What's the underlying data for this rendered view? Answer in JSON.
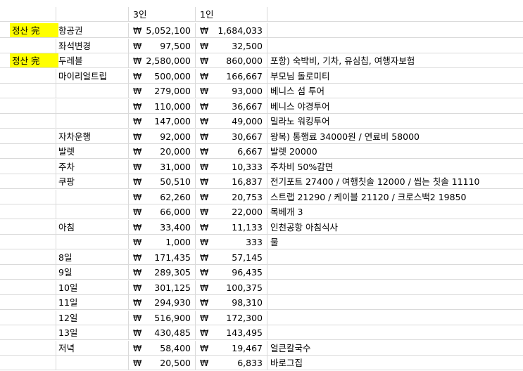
{
  "header": {
    "col3": "3인",
    "col1": "1인"
  },
  "currency_symbol": "₩",
  "highlight_color": "#ffff00",
  "rows": [
    {
      "status": "정산 完",
      "category": "항공권",
      "amount3": "5,052,100",
      "amount1": "1,684,033",
      "note": ""
    },
    {
      "status": "",
      "category": "좌석변경",
      "amount3": "97,500",
      "amount1": "32,500",
      "note": ""
    },
    {
      "status": "정산 完",
      "category": "두레블",
      "amount3": "2,580,000",
      "amount1": "860,000",
      "note": "포항) 숙박비, 기차, 유심칩, 여행자보험"
    },
    {
      "status": "",
      "category": "마이리얼트립",
      "amount3": "500,000",
      "amount1": "166,667",
      "note": "부모님 돌로미티"
    },
    {
      "status": "",
      "category": "",
      "amount3": "279,000",
      "amount1": "93,000",
      "note": "베니스 섬 투어"
    },
    {
      "status": "",
      "category": "",
      "amount3": "110,000",
      "amount1": "36,667",
      "note": "베니스 야경투어"
    },
    {
      "status": "",
      "category": "",
      "amount3": "147,000",
      "amount1": "49,000",
      "note": "밀라노 워킹투어"
    },
    {
      "status": "",
      "category": "자차운행",
      "amount3": "92,000",
      "amount1": "30,667",
      "note": "왕복) 통행료 34000원 / 연료비 58000"
    },
    {
      "status": "",
      "category": "발렛",
      "amount3": "20,000",
      "amount1": "6,667",
      "note": "발렛 20000"
    },
    {
      "status": "",
      "category": "주차",
      "amount3": "31,000",
      "amount1": "10,333",
      "note": "주차비 50%감면"
    },
    {
      "status": "",
      "category": "쿠팡",
      "amount3": "50,510",
      "amount1": "16,837",
      "note": "전기포트 27400 / 여행칫솔 12000 / 씹는 칫솔 11110"
    },
    {
      "status": "",
      "category": "",
      "amount3": "62,260",
      "amount1": "20,753",
      "note": "스트랩 21290 / 케이블 21120 / 크로스백2 19850"
    },
    {
      "status": "",
      "category": "",
      "amount3": "66,000",
      "amount1": "22,000",
      "note": "목베개 3"
    },
    {
      "status": "",
      "category": "아침",
      "amount3": "33,400",
      "amount1": "11,133",
      "note": "인천공항 아침식사"
    },
    {
      "status": "",
      "category": "",
      "amount3": "1,000",
      "amount1": "333",
      "note": "물"
    },
    {
      "status": "",
      "category": "8일",
      "amount3": "171,435",
      "amount1": "57,145",
      "note": ""
    },
    {
      "status": "",
      "category": "9일",
      "amount3": "289,305",
      "amount1": "96,435",
      "note": ""
    },
    {
      "status": "",
      "category": "10일",
      "amount3": "301,125",
      "amount1": "100,375",
      "note": ""
    },
    {
      "status": "",
      "category": "11일",
      "amount3": "294,930",
      "amount1": "98,310",
      "note": ""
    },
    {
      "status": "",
      "category": "12일",
      "amount3": "516,900",
      "amount1": "172,300",
      "note": ""
    },
    {
      "status": "",
      "category": "13일",
      "amount3": "430,485",
      "amount1": "143,495",
      "note": ""
    },
    {
      "status": "",
      "category": "저녁",
      "amount3": "58,400",
      "amount1": "19,467",
      "note": "얼큰칼국수"
    },
    {
      "status": "",
      "category": "",
      "amount3": "20,500",
      "amount1": "6,833",
      "note": "바로그집"
    }
  ]
}
